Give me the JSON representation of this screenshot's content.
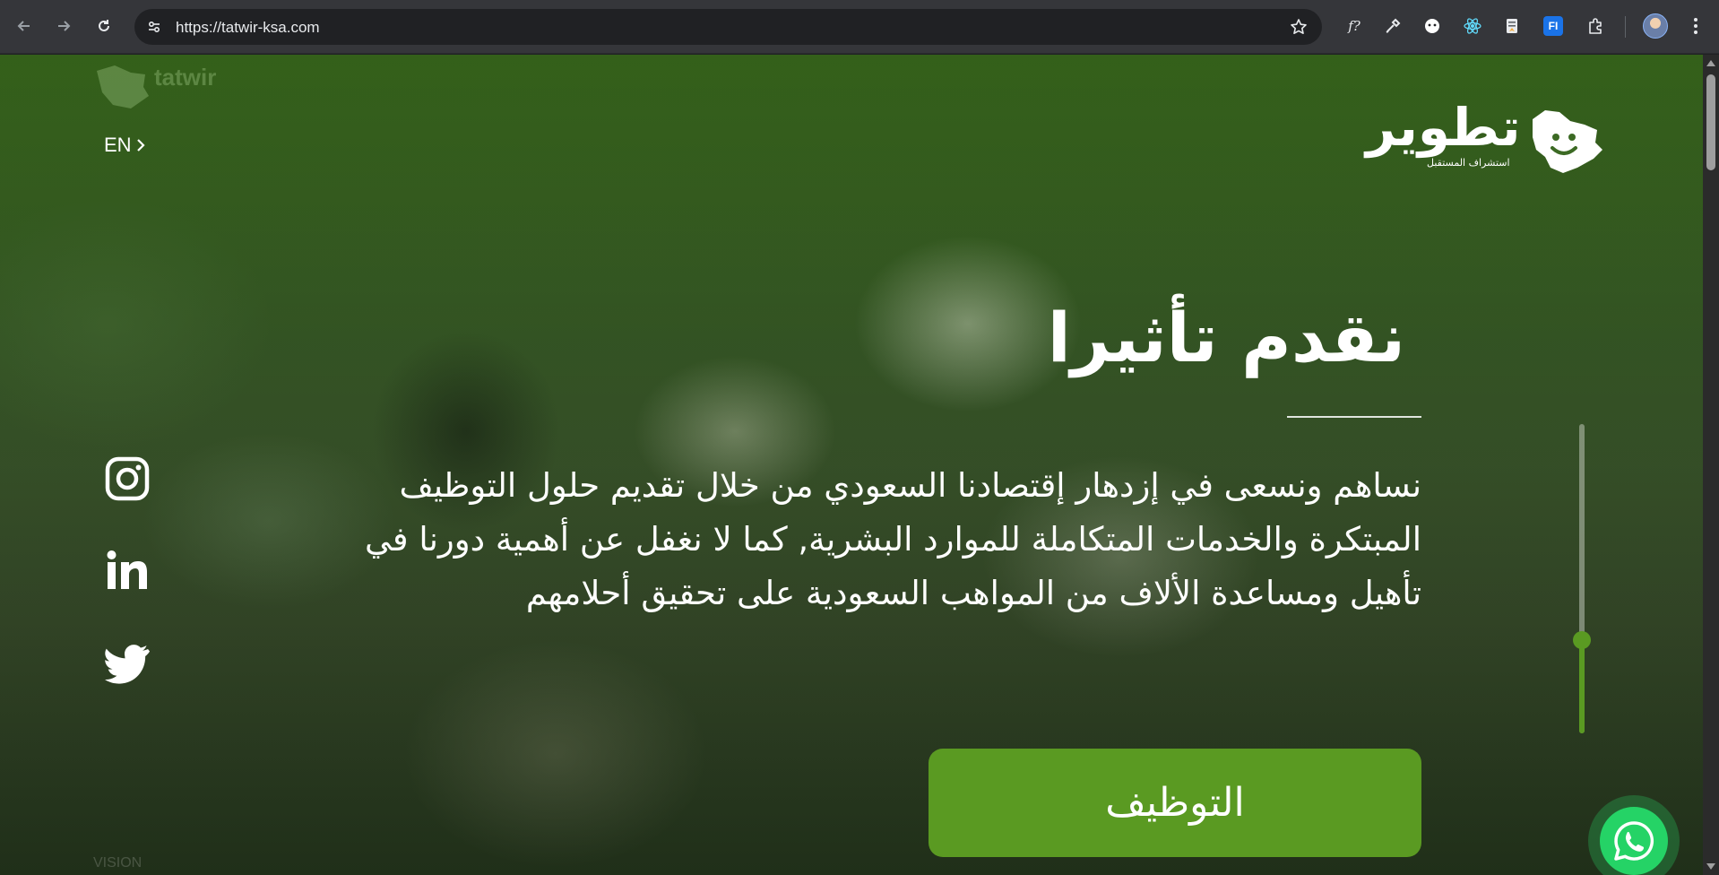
{
  "browser": {
    "url": "https://tatwir-ksa.com",
    "extensions": [
      "fx-icon",
      "eyedropper-icon",
      "face-icon",
      "react-icon",
      "bookmark-doc-icon",
      "fi-icon",
      "puzzle-icon"
    ],
    "ext_fx_label": "f?",
    "ext_fi_label": "FI"
  },
  "header": {
    "lang_label": "EN",
    "logo_word": "تطوير",
    "logo_tagline": "استشراف المستقبل",
    "watermark": "tatwir"
  },
  "hero": {
    "title": "نقدم تأثيرا",
    "text": "نساهم ونسعى في إزدهار إقتصادنا السعودي من خلال تقديم حلول التوظيف المبتكرة والخدمات المتكاملة للموارد البشرية, كما لا نغفل عن أهمية دورنا في تأهيل ومساعدة الألاف من المواهب السعودية على تحقيق أحلامهم",
    "cta_label": "التوظيف"
  },
  "social": [
    "instagram-icon",
    "linkedin-icon",
    "twitter-icon"
  ],
  "slider": {
    "position_fraction": 0.7
  },
  "footer_mark": "VISION",
  "colors": {
    "brand_green": "#5a9a22",
    "whatsapp_green": "#25d366",
    "chrome_bg": "#35363a"
  }
}
